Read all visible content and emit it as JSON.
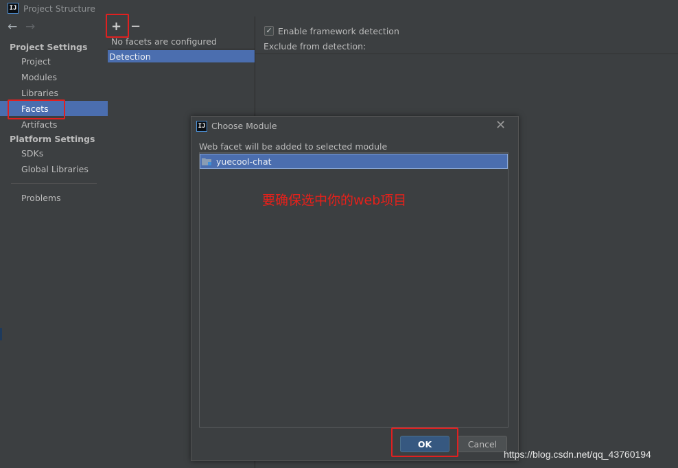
{
  "window": {
    "title": "Project Structure",
    "logo_text": "IJ"
  },
  "nav": {
    "back": "←",
    "forward": "→"
  },
  "sidebar": {
    "project_settings_header": "Project Settings",
    "project_settings_items": [
      "Project",
      "Modules",
      "Libraries",
      "Facets",
      "Artifacts"
    ],
    "platform_settings_header": "Platform Settings",
    "platform_settings_items": [
      "SDKs",
      "Global Libraries"
    ],
    "problems": "Problems",
    "selected": "Facets"
  },
  "facets_pane": {
    "add_label": "+",
    "remove_label": "−",
    "empty_text": "No facets are configured",
    "detection_item": "Detection"
  },
  "detection_panel": {
    "enable_checked": true,
    "enable_label": "Enable framework detection",
    "exclude_label": "Exclude from detection:"
  },
  "dialog": {
    "title": "Choose Module",
    "close": "✕",
    "description": "Web facet will be added to selected module",
    "modules": [
      "yuecool-chat"
    ],
    "ok_label": "OK",
    "cancel_label": "Cancel"
  },
  "annotation_text": "要确保选中你的web项目",
  "watermark": "https://blog.csdn.net/qq_43760194",
  "colors": {
    "background": "#3c3f41",
    "selection": "#4b6eaf",
    "annotation_red": "#e02020",
    "ok_button": "#365880"
  }
}
